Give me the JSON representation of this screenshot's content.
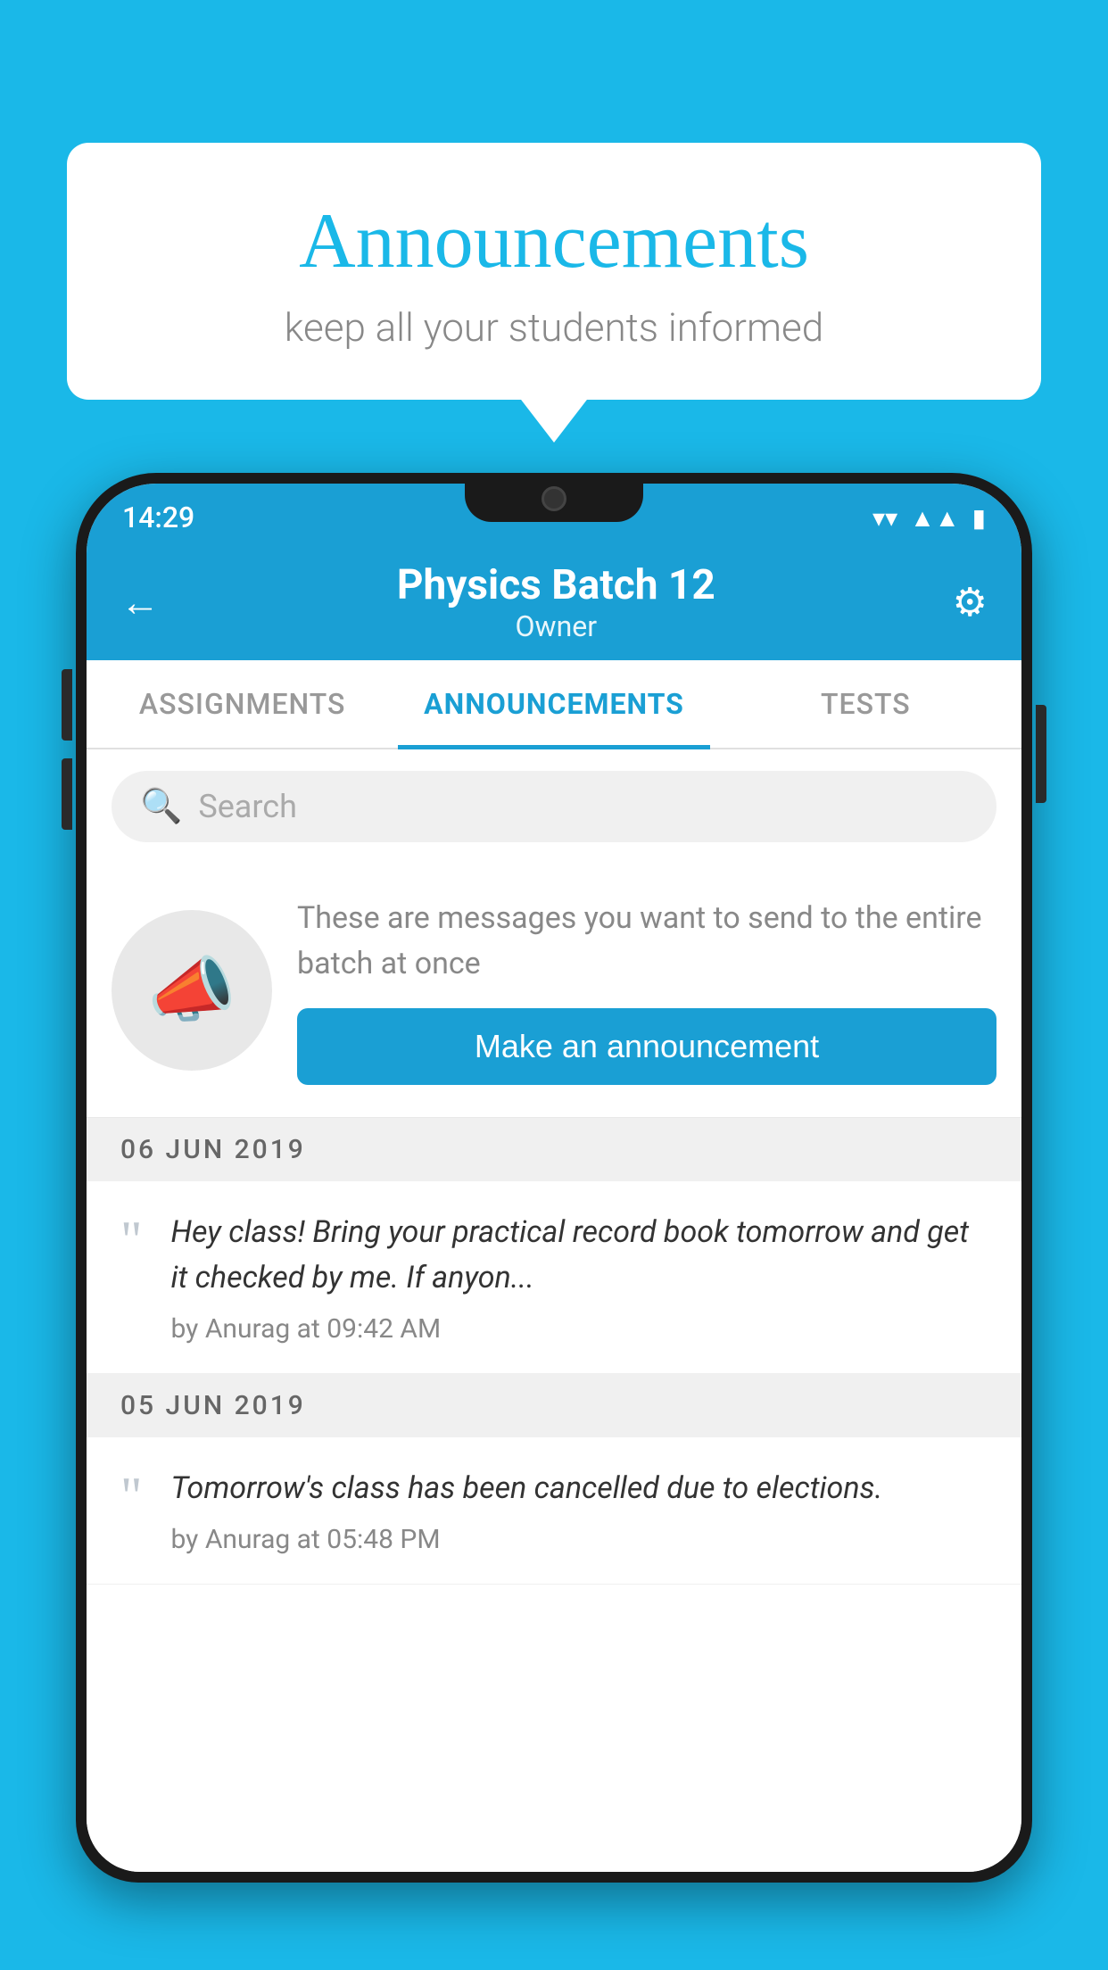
{
  "background_color": "#1ab8e8",
  "speech_bubble": {
    "title": "Announcements",
    "subtitle": "keep all your students informed"
  },
  "phone": {
    "status_bar": {
      "time": "14:29"
    },
    "header": {
      "title": "Physics Batch 12",
      "subtitle": "Owner",
      "back_icon": "←",
      "settings_icon": "⚙"
    },
    "tabs": [
      {
        "label": "ASSIGNMENTS",
        "active": false
      },
      {
        "label": "ANNOUNCEMENTS",
        "active": true
      },
      {
        "label": "TESTS",
        "active": false
      }
    ],
    "search": {
      "placeholder": "Search"
    },
    "empty_state": {
      "description": "These are messages you want to send to the entire batch at once",
      "button_label": "Make an announcement"
    },
    "announcements": [
      {
        "date": "06  JUN  2019",
        "text": "Hey class! Bring your practical record book tomorrow and get it checked by me. If anyon...",
        "meta": "by Anurag at 09:42 AM"
      },
      {
        "date": "05  JUN  2019",
        "text": "Tomorrow's class has been cancelled due to elections.",
        "meta": "by Anurag at 05:48 PM"
      }
    ]
  }
}
